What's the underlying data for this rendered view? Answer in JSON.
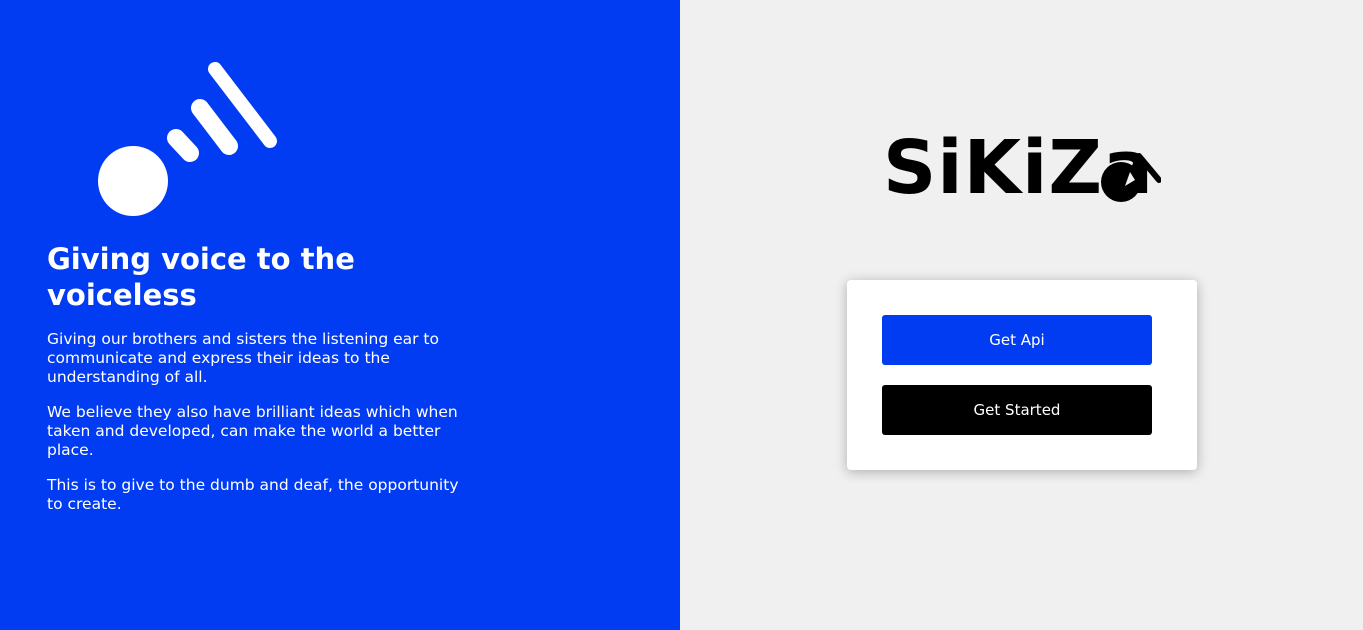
{
  "hero": {
    "heading": "Giving voice to the voiceless",
    "paragraphs": [
      "Giving our brothers and sisters the listening ear to communicate and express their ideas to the understanding of all.",
      "We believe they also have brilliant ideas which when taken and developed, can make the world a better place.",
      "This is to give to the dumb and deaf, the opportunity to create."
    ],
    "icon": "sound-signal-icon"
  },
  "brand": {
    "name": "SiKiZa",
    "mark_icon": "signal-bubble-icon"
  },
  "actions": {
    "get_api_label": "Get Api",
    "get_started_label": "Get Started"
  },
  "colors": {
    "primary_blue": "#023cf2",
    "panel_gray": "#f0f0f0",
    "black": "#000000",
    "white": "#ffffff"
  }
}
